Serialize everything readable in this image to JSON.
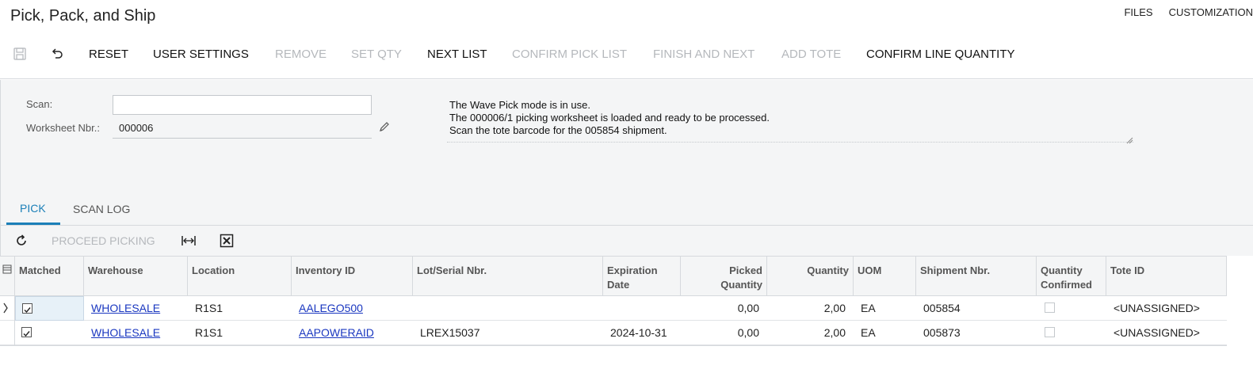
{
  "header": {
    "title": "Pick, Pack, and Ship",
    "links": [
      "FILES",
      "CUSTOMIZATION"
    ]
  },
  "toolbar": {
    "save_icon": "save-icon",
    "undo_icon": "undo-icon",
    "reset": "RESET",
    "user_settings": "USER SETTINGS",
    "remove": "REMOVE",
    "set_qty": "SET QTY",
    "next_list": "NEXT LIST",
    "confirm_pick_list": "CONFIRM PICK LIST",
    "finish_and_next": "FINISH AND NEXT",
    "add_tote": "ADD TOTE",
    "confirm_line_quantity": "CONFIRM LINE QUANTITY"
  },
  "form": {
    "scan_label": "Scan:",
    "scan_value": "",
    "worksheet_label": "Worksheet Nbr.:",
    "worksheet_value": "000006",
    "messages": [
      "The Wave Pick mode is in use.",
      "The 000006/1 picking worksheet is loaded and ready to be processed.",
      "Scan the tote barcode for the 005854 shipment."
    ]
  },
  "tabs": [
    "PICK",
    "SCAN LOG"
  ],
  "grid_toolbar": {
    "refresh_icon": "refresh-icon",
    "proceed_picking": "PROCEED PICKING",
    "fit_icon": "fit-columns-icon",
    "excel_icon": "export-excel-icon"
  },
  "grid": {
    "columns": {
      "matched": "Matched",
      "warehouse": "Warehouse",
      "location": "Location",
      "inventory_id": "Inventory ID",
      "lot_serial": "Lot/Serial Nbr.",
      "expiration_1": "Expiration",
      "expiration_2": "Date",
      "picked_1": "Picked",
      "picked_2": "Quantity",
      "quantity": "Quantity",
      "uom": "UOM",
      "shipment": "Shipment Nbr.",
      "qty_conf_1": "Quantity",
      "qty_conf_2": "Confirmed",
      "tote_id": "Tote ID"
    },
    "rows": [
      {
        "matched": true,
        "warehouse": "WHOLESALE",
        "location": "R1S1",
        "inventory_id": "AALEGO500",
        "lot_serial": "",
        "expiration": "",
        "picked": "0,00",
        "quantity": "2,00",
        "uom": "EA",
        "shipment": "005854",
        "qty_confirmed": false,
        "tote_id": "<UNASSIGNED>"
      },
      {
        "matched": true,
        "warehouse": "WHOLESALE",
        "location": "R1S1",
        "inventory_id": "AAPOWERAID",
        "lot_serial": "LREX15037",
        "expiration": "2024-10-31",
        "picked": "0,00",
        "quantity": "2,00",
        "uom": "EA",
        "shipment": "005873",
        "qty_confirmed": false,
        "tote_id": "<UNASSIGNED>"
      }
    ]
  },
  "colors": {
    "accent": "#1b7fb8",
    "link": "#1a37c0",
    "disabled": "#b5b8bc",
    "selected_row": "#e7f1f8"
  }
}
